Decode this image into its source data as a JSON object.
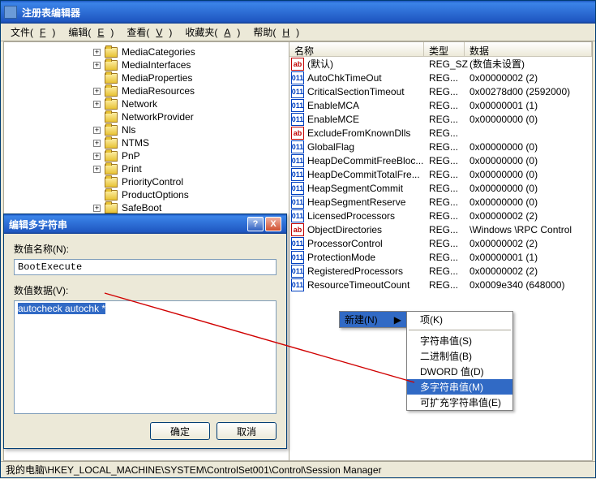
{
  "title": "注册表编辑器",
  "menubar": [
    {
      "label": "文件",
      "accel": "F"
    },
    {
      "label": "编辑",
      "accel": "E"
    },
    {
      "label": "查看",
      "accel": "V"
    },
    {
      "label": "收藏夹",
      "accel": "A"
    },
    {
      "label": "帮助",
      "accel": "H"
    }
  ],
  "tree": [
    {
      "exp": "+",
      "label": "MediaCategories"
    },
    {
      "exp": "+",
      "label": "MediaInterfaces"
    },
    {
      "exp": " ",
      "label": "MediaProperties"
    },
    {
      "exp": "+",
      "label": "MediaResources"
    },
    {
      "exp": "+",
      "label": "Network"
    },
    {
      "exp": " ",
      "label": "NetworkProvider"
    },
    {
      "exp": "+",
      "label": "Nls"
    },
    {
      "exp": "+",
      "label": "NTMS"
    },
    {
      "exp": "+",
      "label": "PnP"
    },
    {
      "exp": "+",
      "label": "Print"
    },
    {
      "exp": " ",
      "label": "PriorityControl"
    },
    {
      "exp": " ",
      "label": "ProductOptions"
    },
    {
      "exp": "+",
      "label": "SafeBoot"
    }
  ],
  "list_headers": {
    "name": "名称",
    "type": "类型",
    "data": "数据"
  },
  "list": [
    {
      "ico": "sz",
      "name": "(默认)",
      "type": "REG_SZ",
      "data": "(数值未设置)"
    },
    {
      "ico": "dw",
      "name": "AutoChkTimeOut",
      "type": "REG...",
      "data": "0x00000002 (2)"
    },
    {
      "ico": "dw",
      "name": "CriticalSectionTimeout",
      "type": "REG...",
      "data": "0x00278d00 (2592000)"
    },
    {
      "ico": "dw",
      "name": "EnableMCA",
      "type": "REG...",
      "data": "0x00000001 (1)"
    },
    {
      "ico": "dw",
      "name": "EnableMCE",
      "type": "REG...",
      "data": "0x00000000 (0)"
    },
    {
      "ico": "sz",
      "name": "ExcludeFromKnownDlls",
      "type": "REG...",
      "data": ""
    },
    {
      "ico": "dw",
      "name": "GlobalFlag",
      "type": "REG...",
      "data": "0x00000000 (0)"
    },
    {
      "ico": "dw",
      "name": "HeapDeCommitFreeBloc...",
      "type": "REG...",
      "data": "0x00000000 (0)"
    },
    {
      "ico": "dw",
      "name": "HeapDeCommitTotalFre...",
      "type": "REG...",
      "data": "0x00000000 (0)"
    },
    {
      "ico": "dw",
      "name": "HeapSegmentCommit",
      "type": "REG...",
      "data": "0x00000000 (0)"
    },
    {
      "ico": "dw",
      "name": "HeapSegmentReserve",
      "type": "REG...",
      "data": "0x00000000 (0)"
    },
    {
      "ico": "dw",
      "name": "LicensedProcessors",
      "type": "REG...",
      "data": "0x00000002 (2)"
    },
    {
      "ico": "sz",
      "name": "ObjectDirectories",
      "type": "REG...",
      "data": "\\Windows \\RPC Control"
    },
    {
      "ico": "dw",
      "name": "ProcessorControl",
      "type": "REG...",
      "data": "0x00000002 (2)"
    },
    {
      "ico": "dw",
      "name": "ProtectionMode",
      "type": "REG...",
      "data": "0x00000001 (1)"
    },
    {
      "ico": "dw",
      "name": "RegisteredProcessors",
      "type": "REG...",
      "data": "0x00000002 (2)"
    },
    {
      "ico": "dw",
      "name": "ResourceTimeoutCount",
      "type": "REG...",
      "data": "0x0009e340 (648000)"
    }
  ],
  "statusbar": "我的电脑\\HKEY_LOCAL_MACHINE\\SYSTEM\\ControlSet001\\Control\\Session Manager",
  "dialog": {
    "title": "编辑多字符串",
    "name_label": "数值名称(N):",
    "name_value": "BootExecute",
    "data_label": "数值数据(V):",
    "data_value": "autocheck autochk *",
    "ok": "确定",
    "cancel": "取消"
  },
  "context": {
    "new": "新建(N)",
    "submenu": [
      {
        "label": "项(K)",
        "hl": false,
        "sep": false
      },
      {
        "sep": true
      },
      {
        "label": "字符串值(S)",
        "hl": false,
        "sep": false
      },
      {
        "label": "二进制值(B)",
        "hl": false,
        "sep": false
      },
      {
        "label": "DWORD 值(D)",
        "hl": false,
        "sep": false
      },
      {
        "label": "多字符串值(M)",
        "hl": true,
        "sep": false
      },
      {
        "label": "可扩充字符串值(E)",
        "hl": false,
        "sep": false
      }
    ]
  }
}
